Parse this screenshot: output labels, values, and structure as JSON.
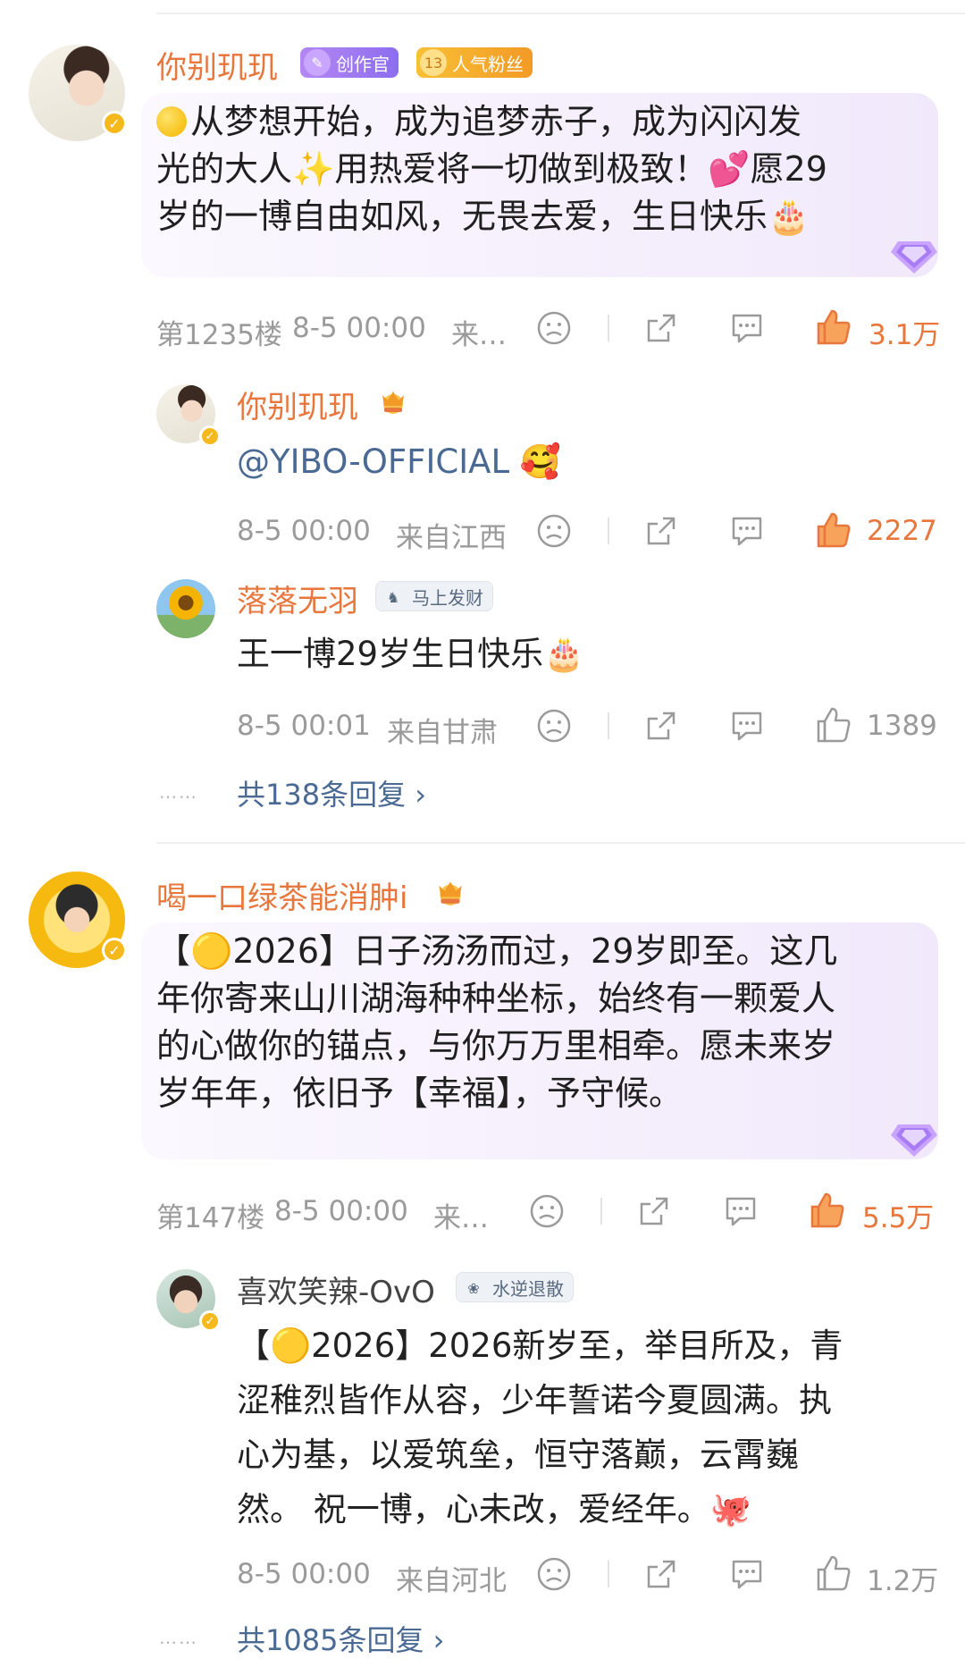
{
  "comments": [
    {
      "user": "你别玑玑",
      "badges": [
        "创作官",
        "13",
        "人气粉丝"
      ],
      "text_before_emoji": "从梦想开始，成为追梦赤子，成为闪闪发光的大人",
      "text_line1": "从梦想开始，成为追梦赤子，成为闪闪发",
      "text_line2": "光的大人✨用热爱将一切做到极致！💕愿29",
      "text_line3": "岁的一博自由如风，无畏去爱，生日快乐🎂",
      "floor": "第1235楼",
      "time": "8-5 00:00",
      "source": "来…",
      "likes": "3.1万",
      "replies": [
        {
          "user": "你别玑玑",
          "text": "@YIBO-OFFICIAL 🥰",
          "time": "8-5 00:00",
          "source": "来自江西",
          "likes": "2227"
        },
        {
          "user": "落落无羽",
          "badge": "马上发财",
          "text": "王一博29岁生日快乐🎂",
          "time": "8-5 00:01",
          "source": "来自甘肃",
          "likes": "1389"
        }
      ],
      "more": "共138条回复 ›"
    },
    {
      "user": "喝一口绿茶能消肿i",
      "text_line1": "【🟡2026】日子汤汤而过，29岁即至。这几",
      "text_line2": "年你寄来山川湖海种种坐标，始终有一颗爱人",
      "text_line3": "的心做你的锚点，与你万万里相牵。愿未来岁",
      "text_line4": "岁年年，依旧予【幸福】，予守候。",
      "floor": "第147楼",
      "time": "8-5 00:00",
      "source": "来…",
      "likes": "5.5万",
      "replies": [
        {
          "user": "喜欢笑辣-OvO",
          "badge": "水逆退散",
          "text_line1": "【🟡2026】2026新岁至，举目所及，青",
          "text_line2": "涩稚烈皆作从容，少年誓诺今夏圆满。执",
          "text_line3": "心为基，以爱筑垒，恒守落巅，云霄巍",
          "text_line4": "然。 祝一博，心未改，爱经年。🐙",
          "time": "8-5 00:00",
          "source": "来自河北",
          "likes": "1.2万"
        }
      ],
      "more": "共1085条回复 ›"
    }
  ],
  "colors": {
    "accent": "#e8773d",
    "link": "#4a6a94",
    "meta": "#9a9a9a"
  },
  "dots": "……"
}
